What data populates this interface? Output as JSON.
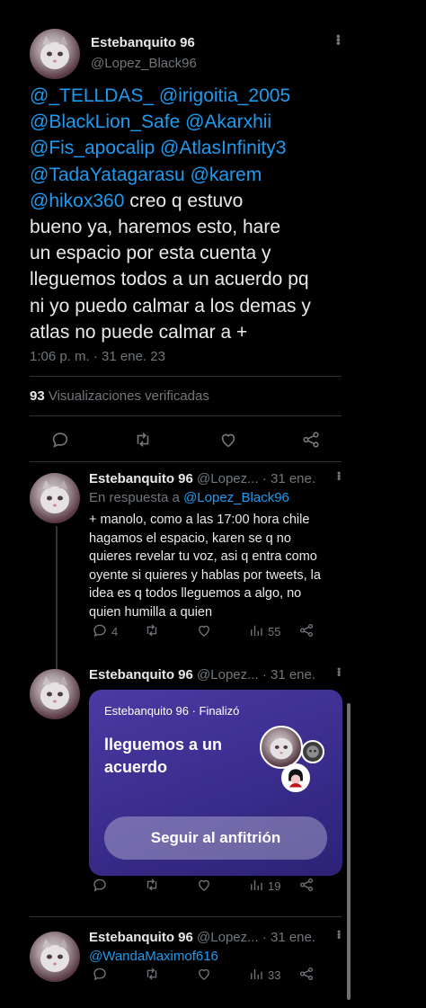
{
  "main_tweet": {
    "author_name": "Estebanquito 96",
    "author_handle": "@Lopez_Black96",
    "lines": [
      {
        "mentions": "@_TELLDAS_ @irigoitia_2005",
        "text": ""
      },
      {
        "mentions": "@BlackLion_Safe @Akarxhii",
        "text": ""
      },
      {
        "mentions": "@Fis_apocalip @AtlasInfinity3",
        "text": ""
      },
      {
        "mentions": "@TadaYatagarasu @karem",
        "text": ""
      },
      {
        "mentions": "@hikox360",
        "text": " creo q estuvo"
      },
      {
        "mentions": "",
        "text": "bueno ya, haremos esto, hare"
      },
      {
        "mentions": "",
        "text": "un espacio por esta cuenta y"
      },
      {
        "mentions": "",
        "text": "lleguemos todos a un acuerdo pq"
      },
      {
        "mentions": "",
        "text": "ni yo puedo calmar a los demas y"
      },
      {
        "mentions": "",
        "text": "atlas no puede calmar a +"
      }
    ],
    "timestamp": "1:06 p. m. · 31 ene. 23",
    "views_count": "93",
    "views_label": "Visualizaciones verificadas"
  },
  "replies": [
    {
      "author_name": "Estebanquito 96",
      "author_handle": "@Lopez...",
      "date": "· 31 ene.",
      "reply_prefix": "En respuesta a ",
      "reply_to": "@Lopez_Black96",
      "text_lines": [
        "+ manolo, como a las 17:00 hora chile",
        "hagamos el espacio, karen se q no",
        "quieres revelar tu voz, asi q entra como",
        "oyente si quieres y hablas por tweets, la",
        "idea es q todos lleguemos a algo, no",
        "quien humilla a quien"
      ],
      "reply_count": "4",
      "views": "55"
    },
    {
      "author_name": "Estebanquito 96",
      "author_handle": "@Lopez...",
      "date": "· 31 ene.",
      "space": {
        "header": "Estebanquito 96 · Finalizó",
        "title_line1": "lleguemos a un",
        "title_line2": "acuerdo",
        "button_label": "Seguir al anfitrión"
      },
      "views": "19"
    },
    {
      "author_name": "Estebanquito 96",
      "author_handle": "@Lopez...",
      "date": "· 31 ene.",
      "mention": "@WandaMaximof616",
      "views": "33"
    }
  ],
  "colors": {
    "background": "#000000",
    "text": "#e7e9ea",
    "muted": "#71767b",
    "link": "#1d9bf0",
    "space_card": "#3a2c8c"
  }
}
